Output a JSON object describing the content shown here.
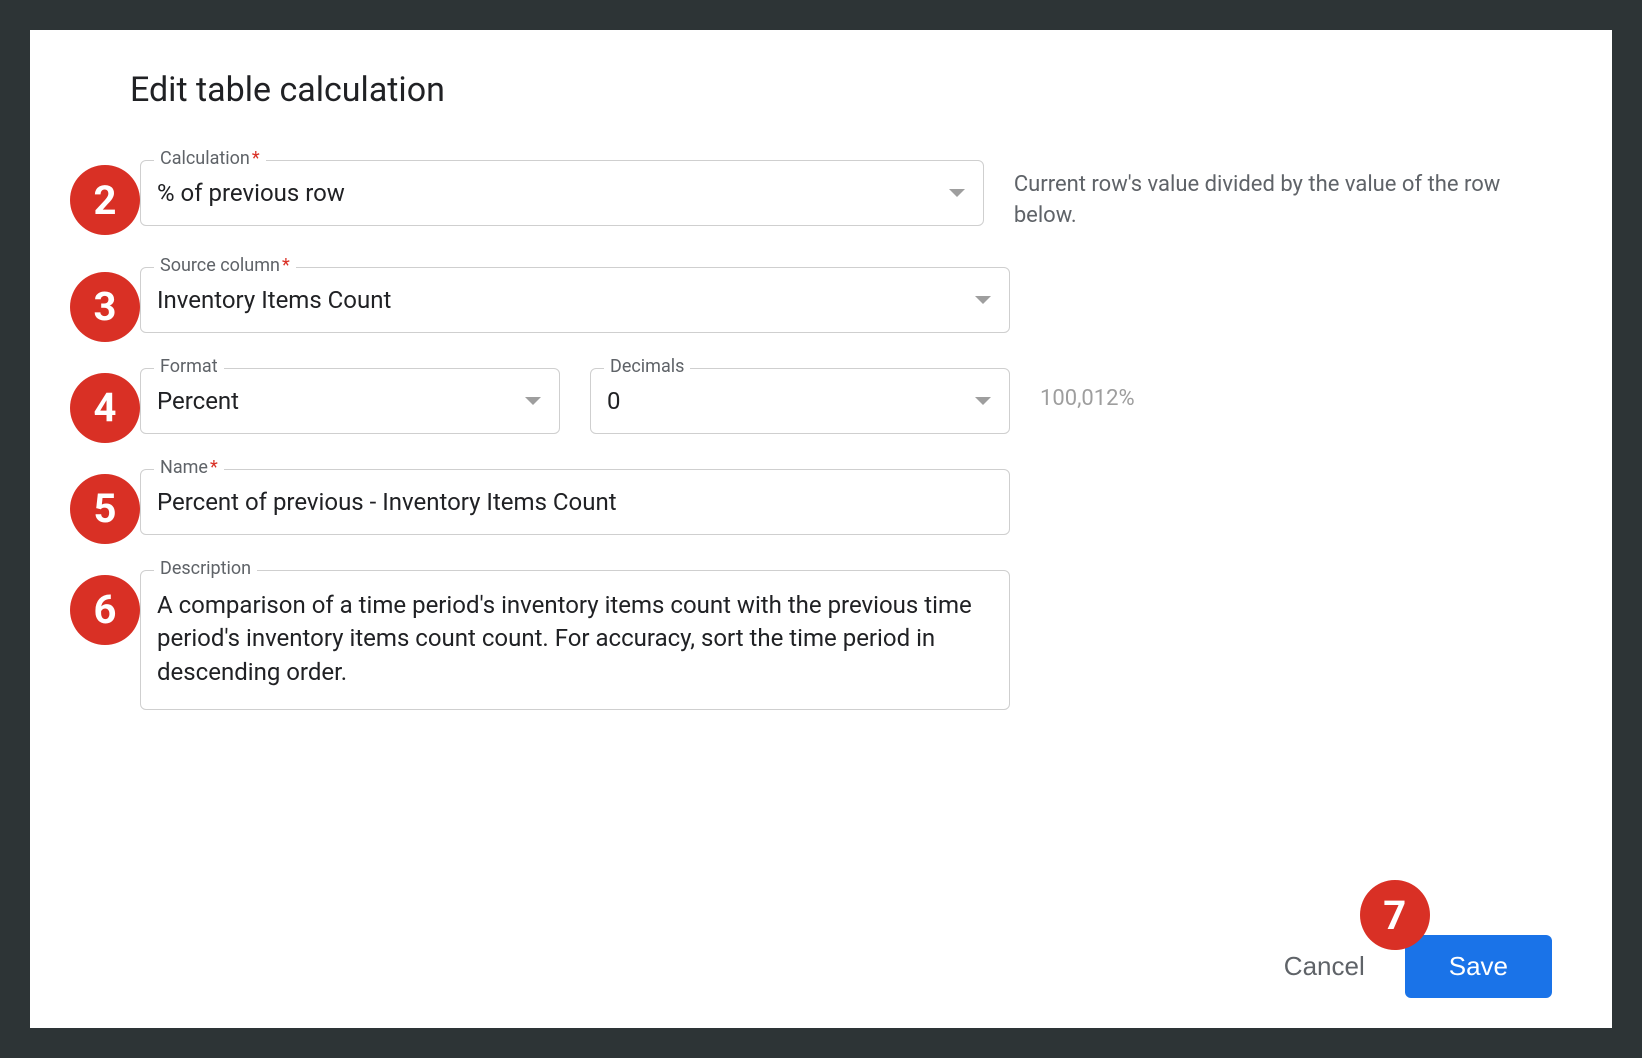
{
  "dialog": {
    "title": "Edit table calculation"
  },
  "badges": {
    "calculation": "2",
    "source": "3",
    "format": "4",
    "name": "5",
    "description": "6",
    "save": "7"
  },
  "fields": {
    "calculation": {
      "label": "Calculation",
      "value": "% of previous row",
      "help": "Current row's value divided by the value of the row below."
    },
    "source": {
      "label": "Source column",
      "value": "Inventory Items Count"
    },
    "format": {
      "label": "Format",
      "value": "Percent"
    },
    "decimals": {
      "label": "Decimals",
      "value": "0",
      "preview": "100,012%"
    },
    "name": {
      "label": "Name",
      "value": "Percent of previous -  Inventory Items Count"
    },
    "description": {
      "label": "Description",
      "value": "A comparison of a time period's inventory items count with the previous time period's inventory items count count. For accuracy, sort the time period in descending order."
    }
  },
  "buttons": {
    "cancel": "Cancel",
    "save": "Save"
  }
}
